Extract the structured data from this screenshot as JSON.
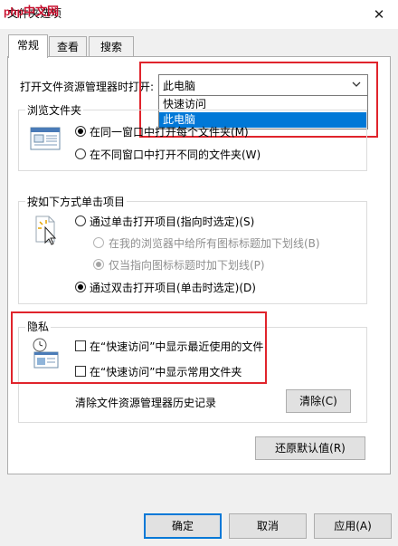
{
  "window": {
    "title": "文件夹选项",
    "close_glyph": "✕"
  },
  "watermark": {
    "latin": "php",
    "cn": "中文网"
  },
  "tabs": [
    {
      "label": "常规",
      "active": true
    },
    {
      "label": "查看",
      "active": false
    },
    {
      "label": "搜索",
      "active": false
    }
  ],
  "open_explorer": {
    "label": "打开文件资源管理器时打开:",
    "selected": "此电脑",
    "options": [
      "快速访问",
      "此电脑"
    ],
    "highlighted_option": "此电脑"
  },
  "browse_folders": {
    "legend": "浏览文件夹",
    "options": [
      {
        "label": "在同一窗口中打开每个文件夹(M)",
        "checked": true
      },
      {
        "label": "在不同窗口中打开不同的文件夹(W)",
        "checked": false
      }
    ]
  },
  "click_items": {
    "legend": "按如下方式单击项目",
    "single_click": {
      "label": "通过单击打开项目(指向时选定)(S)",
      "checked": false
    },
    "underline_all": {
      "label": "在我的浏览器中给所有图标标题加下划线(B)",
      "checked": false
    },
    "underline_point": {
      "label": "仅当指向图标标题时加下划线(P)",
      "checked": true
    },
    "double_click": {
      "label": "通过双击打开项目(单击时选定)(D)",
      "checked": true
    }
  },
  "privacy": {
    "legend": "隐私",
    "show_recent": {
      "label": "在“快速访问”中显示最近使用的文件",
      "checked": false
    },
    "show_frequent": {
      "label": "在“快速访问”中显示常用文件夹",
      "checked": false
    },
    "clear_label": "清除文件资源管理器历史记录",
    "clear_button": "清除(C)"
  },
  "restore_defaults_button": "还原默认值(R)",
  "footer": {
    "ok": "确定",
    "cancel": "取消",
    "apply": "应用(A)"
  },
  "colors": {
    "highlight_box": "#e0242c",
    "selection_blue": "#0078d7"
  }
}
